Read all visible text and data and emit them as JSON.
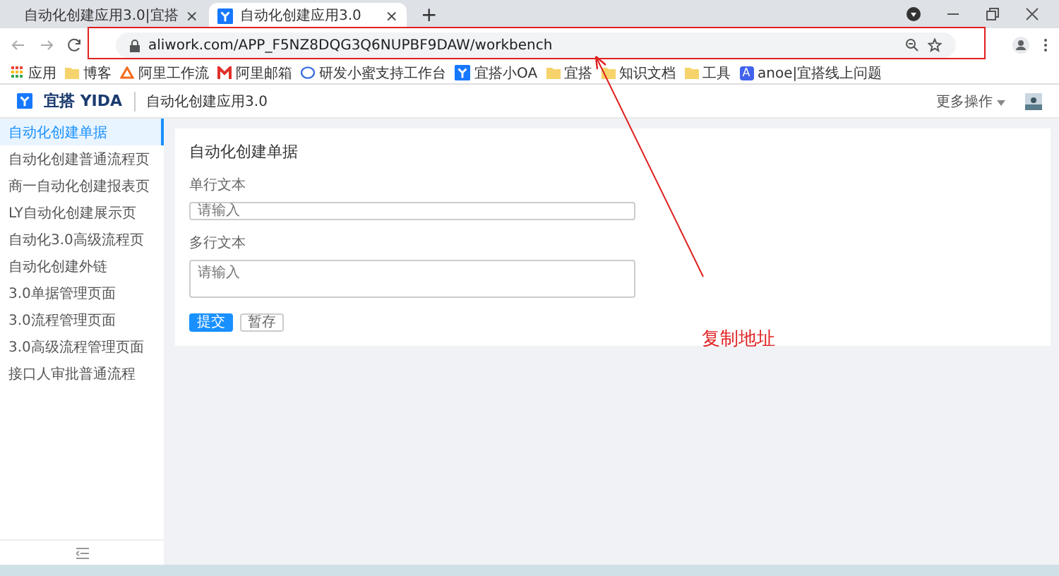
{
  "browser": {
    "tabs": [
      {
        "title": "自动化创建应用3.0|宜搭",
        "selected": false
      },
      {
        "title": "自动化创建应用3.0",
        "selected": true
      }
    ],
    "close_glyph": "×",
    "new_tab_glyph": "+",
    "address": "aliwork.com/APP_F5NZ8DQG3Q6NUPBF9DAW/workbench",
    "bookmarks": [
      {
        "kind": "apps",
        "label": "应用"
      },
      {
        "kind": "folder",
        "label": "博客"
      },
      {
        "kind": "flow",
        "label": "阿里工作流"
      },
      {
        "kind": "mail",
        "label": "阿里邮箱"
      },
      {
        "kind": "chat",
        "label": "研发小蜜支持工作台"
      },
      {
        "kind": "yida",
        "label": "宜搭小OA"
      },
      {
        "kind": "folder",
        "label": "宜搭"
      },
      {
        "kind": "folder",
        "label": "知识文档"
      },
      {
        "kind": "folder",
        "label": "工具"
      },
      {
        "kind": "letter",
        "badge": "A",
        "label": "anoe|宜搭线上问题"
      }
    ]
  },
  "app_header": {
    "logo_text": "宜搭",
    "logo_latin": "YIDA",
    "app_name": "自动化创建应用3.0",
    "more": "更多操作"
  },
  "sidebar": {
    "items": [
      {
        "label": "自动化创建单据",
        "selected": true
      },
      {
        "label": "自动化创建普通流程页",
        "selected": false
      },
      {
        "label": "商一自动化创建报表页",
        "selected": false
      },
      {
        "label": "LY自动化创建展示页",
        "selected": false
      },
      {
        "label": "自动化3.0高级流程页",
        "selected": false
      },
      {
        "label": "自动化创建外链",
        "selected": false
      },
      {
        "label": "3.0单据管理页面",
        "selected": false
      },
      {
        "label": "3.0流程管理页面",
        "selected": false
      },
      {
        "label": "3.0高级流程管理页面",
        "selected": false
      },
      {
        "label": "接口人审批普通流程",
        "selected": false
      }
    ]
  },
  "form": {
    "title": "自动化创建单据",
    "fields": [
      {
        "kind": "single",
        "label": "单行文本",
        "placeholder": "请输入"
      },
      {
        "kind": "multi",
        "label": "多行文本",
        "placeholder": "请输入"
      }
    ],
    "buttons": [
      {
        "label": "提交",
        "kind": "primary"
      },
      {
        "label": "暂存",
        "kind": "secondary"
      }
    ]
  },
  "annotation": {
    "text": "复制地址"
  }
}
